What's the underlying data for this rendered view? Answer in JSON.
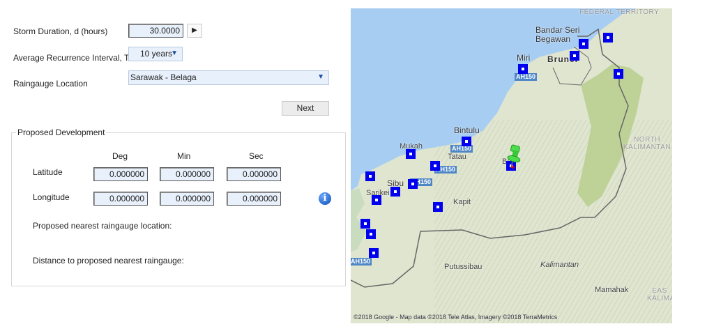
{
  "form": {
    "storm_duration_label": "Storm Duration, d (hours)",
    "storm_duration_value": "30.0000",
    "run_button_icon": "play-icon",
    "ari_label": "Average Recurrence Interval, T",
    "ari_value": "10 years",
    "raingauge_label": "Raingauge Location",
    "raingauge_value": "Sarawak - Belaga",
    "next_label": "Next"
  },
  "proposed": {
    "legend": "Proposed Development",
    "col_headers": [
      "Deg",
      "Min",
      "Sec"
    ],
    "latitude_label": "Latitude",
    "latitude": [
      "0.000000",
      "0.000000",
      "0.000000"
    ],
    "longitude_label": "Longitude",
    "longitude": [
      "0.000000",
      "0.000000",
      "0.000000"
    ],
    "info_icon": "info-icon",
    "nearest_label": "Proposed nearest raingauge location:",
    "distance_label": "Distance to proposed nearest raingauge:"
  },
  "map": {
    "labels": {
      "federal_territory": "FEDERAL TERRITORY",
      "bandar": "Bandar Seri Begawan",
      "brunei": "Brunei",
      "miri": "Miri",
      "bintulu": "Bintulu",
      "mukah": "Mukah",
      "tatau": "Tatau",
      "sibu": "Sibu",
      "sarikei": "Sarikei",
      "kapit": "Kapit",
      "belaga": "Be",
      "north_kalimantan": "NORTH KALIMANTAN",
      "putussibau": "Putussibau",
      "kalimantan": "Kalimantan",
      "mamahak": "Mamahak",
      "east_kalimantan": "EAS KALIMA"
    },
    "road": "AH150",
    "attribution": "©2018 Google - Map data ©2018 Tele Atlas, Imagery ©2018 TerraMetrics",
    "selected_pin_color": "#33cc33",
    "marker_color": "#0000ee",
    "sea_color": "#a7cdf2"
  }
}
